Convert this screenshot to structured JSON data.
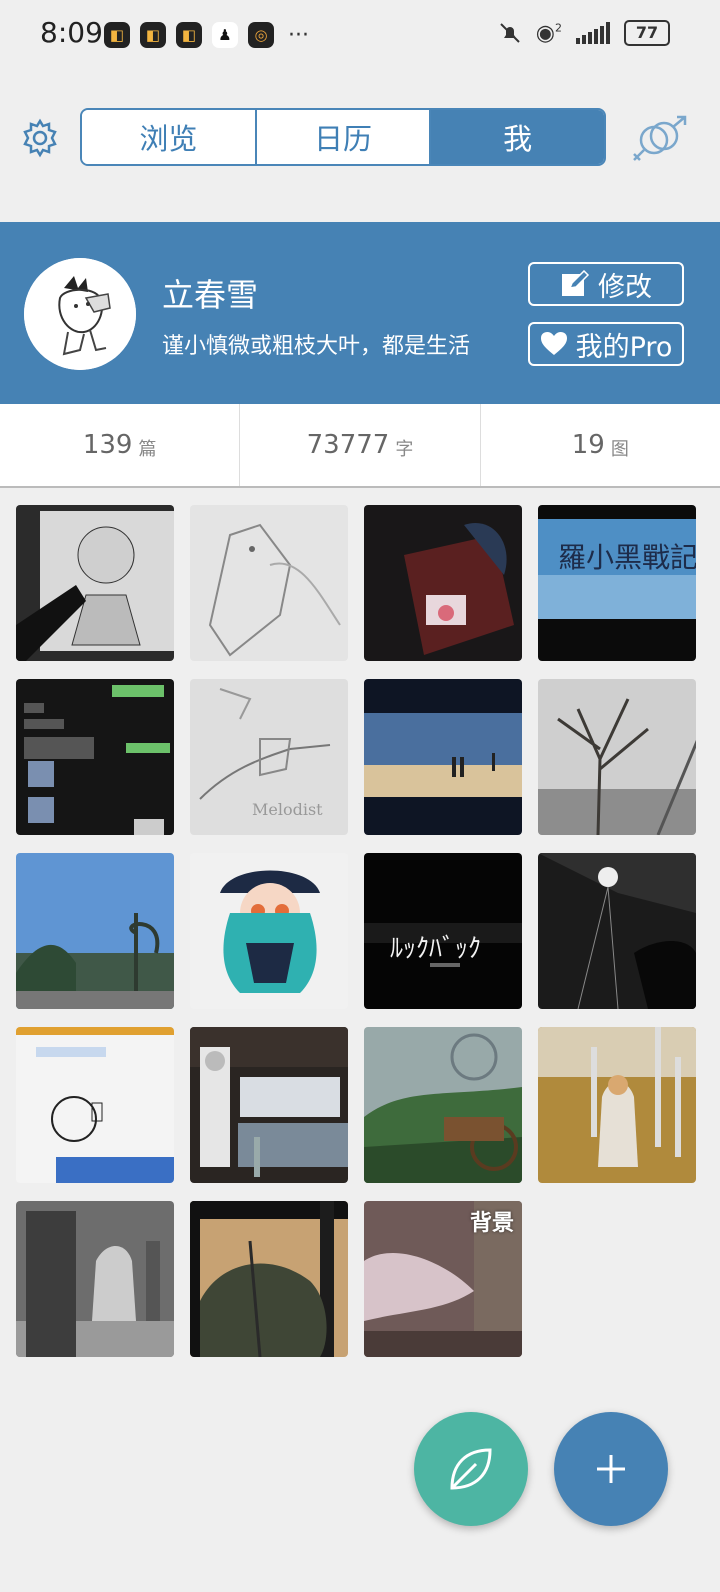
{
  "status_bar": {
    "time": "8:09",
    "more": "···",
    "battery": "77",
    "network_sup": "2"
  },
  "tabs": [
    {
      "label": "浏览"
    },
    {
      "label": "日历"
    },
    {
      "label": "我",
      "active": true
    }
  ],
  "profile": {
    "name": "立春雪",
    "bio": "谨小慎微或粗枝大叶，都是生活",
    "edit_label": "修改",
    "pro_label": "我的Pro"
  },
  "stats": [
    {
      "value": "139",
      "unit": "篇"
    },
    {
      "value": "73777",
      "unit": "字"
    },
    {
      "value": "19",
      "unit": "图"
    }
  ],
  "grid_tag": "背景",
  "colors": {
    "accent": "#4682b4",
    "leaf_fab": "#4db5a3",
    "background": "#efefef"
  },
  "icons": [
    "settings-gear-icon",
    "gender-icon",
    "edit-icon",
    "heart-icon",
    "leaf-icon",
    "plus-icon"
  ]
}
